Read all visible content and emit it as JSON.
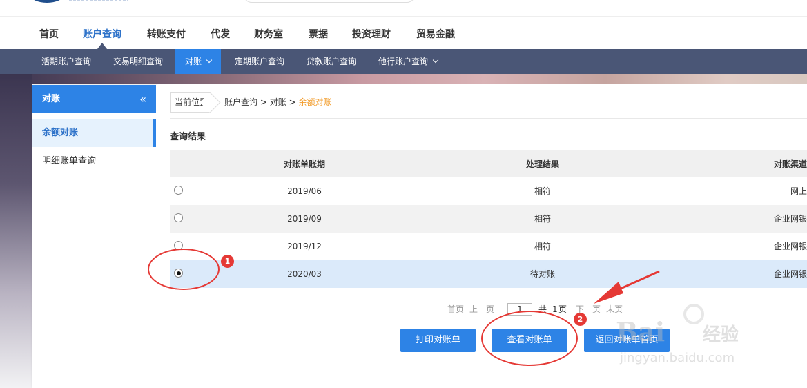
{
  "main_nav": {
    "items": [
      "首页",
      "账户查询",
      "转账支付",
      "代发",
      "财务室",
      "票据",
      "投资理财",
      "贸易金融"
    ],
    "active": "账户查询"
  },
  "sub_nav": {
    "items": [
      "活期账户查询",
      "交易明细查询",
      "对账",
      "定期账户查询",
      "贷款账户查询",
      "他行账户查询"
    ],
    "active": "对账"
  },
  "sidebar": {
    "title": "对账",
    "collapse_glyph": "«",
    "items": [
      "余额对账",
      "明细账单查询"
    ]
  },
  "breadcrumb": {
    "label": "当前位置",
    "path1": "账户查询",
    "path2": "对账",
    "current": "余额对账",
    "sep": ">"
  },
  "results": {
    "title": "查询结果",
    "headers": [
      "对账单账期",
      "处理结果",
      "对账渠道"
    ],
    "rows": [
      {
        "period": "2019/06",
        "result": "相符",
        "channel": "网上",
        "selected": false
      },
      {
        "period": "2019/09",
        "result": "相符",
        "channel": "企业网银",
        "selected": false
      },
      {
        "period": "2019/12",
        "result": "相符",
        "channel": "企业网银",
        "selected": false
      },
      {
        "period": "2020/03",
        "result": "待对账",
        "channel": "企业网银",
        "selected": true
      }
    ]
  },
  "pager": {
    "first": "首页",
    "prev": "上一页",
    "page": "1",
    "total_prefix": "共",
    "total_pages": "1",
    "total_suffix": "页",
    "next": "下一页",
    "last": "末页"
  },
  "buttons": {
    "print": "打印对账单",
    "view": "查看对账单",
    "back": "返回对账单首页"
  },
  "annotations": {
    "badge1": "1",
    "badge2": "2",
    "color": "#e53935"
  },
  "watermark": {
    "brand": "Bai",
    "brand_cn": "经验",
    "url": "jingyan.baidu.com"
  },
  "colors": {
    "accent": "#2d83e6",
    "subnav_bg": "#4a5676",
    "breadcrumb_current": "#f29c2b"
  }
}
